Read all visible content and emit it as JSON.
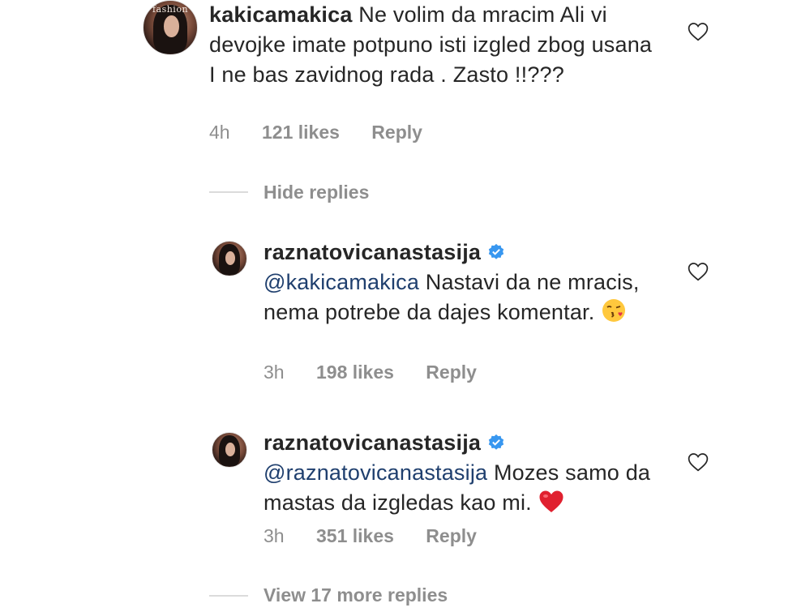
{
  "comments": [
    {
      "username": "kakicamakica",
      "text": "Ne volim da mracim Ali vi devojke imate potpuno isti izgled  zbog usana I ne bas zavidnog rada . Zasto !!???",
      "time": "4h",
      "likes": "121 likes",
      "reply": "Reply",
      "avatar_text": "fashion"
    }
  ],
  "hide_replies": "Hide replies",
  "replies": [
    {
      "username": "raznatovicanastasija",
      "verified": true,
      "mention": "@kakicamakica",
      "text": "Nastavi da ne mracis, nema potrebe da dajes komentar.",
      "emoji": "kissing-face-emoji",
      "time": "3h",
      "likes": "198 likes",
      "reply": "Reply"
    },
    {
      "username": "raznatovicanastasija",
      "verified": true,
      "mention": "@raznatovicanastasija",
      "text": "Mozes samo da mastas da izgledas kao mi.",
      "emoji": "red-heart-emoji",
      "time": "3h",
      "likes": "351 likes",
      "reply": "Reply"
    }
  ],
  "view_more": "View 17 more replies",
  "colors": {
    "verified_blue": "#3897f0",
    "mention": "#1f3f6e",
    "meta_gray": "#8e8e8e"
  }
}
